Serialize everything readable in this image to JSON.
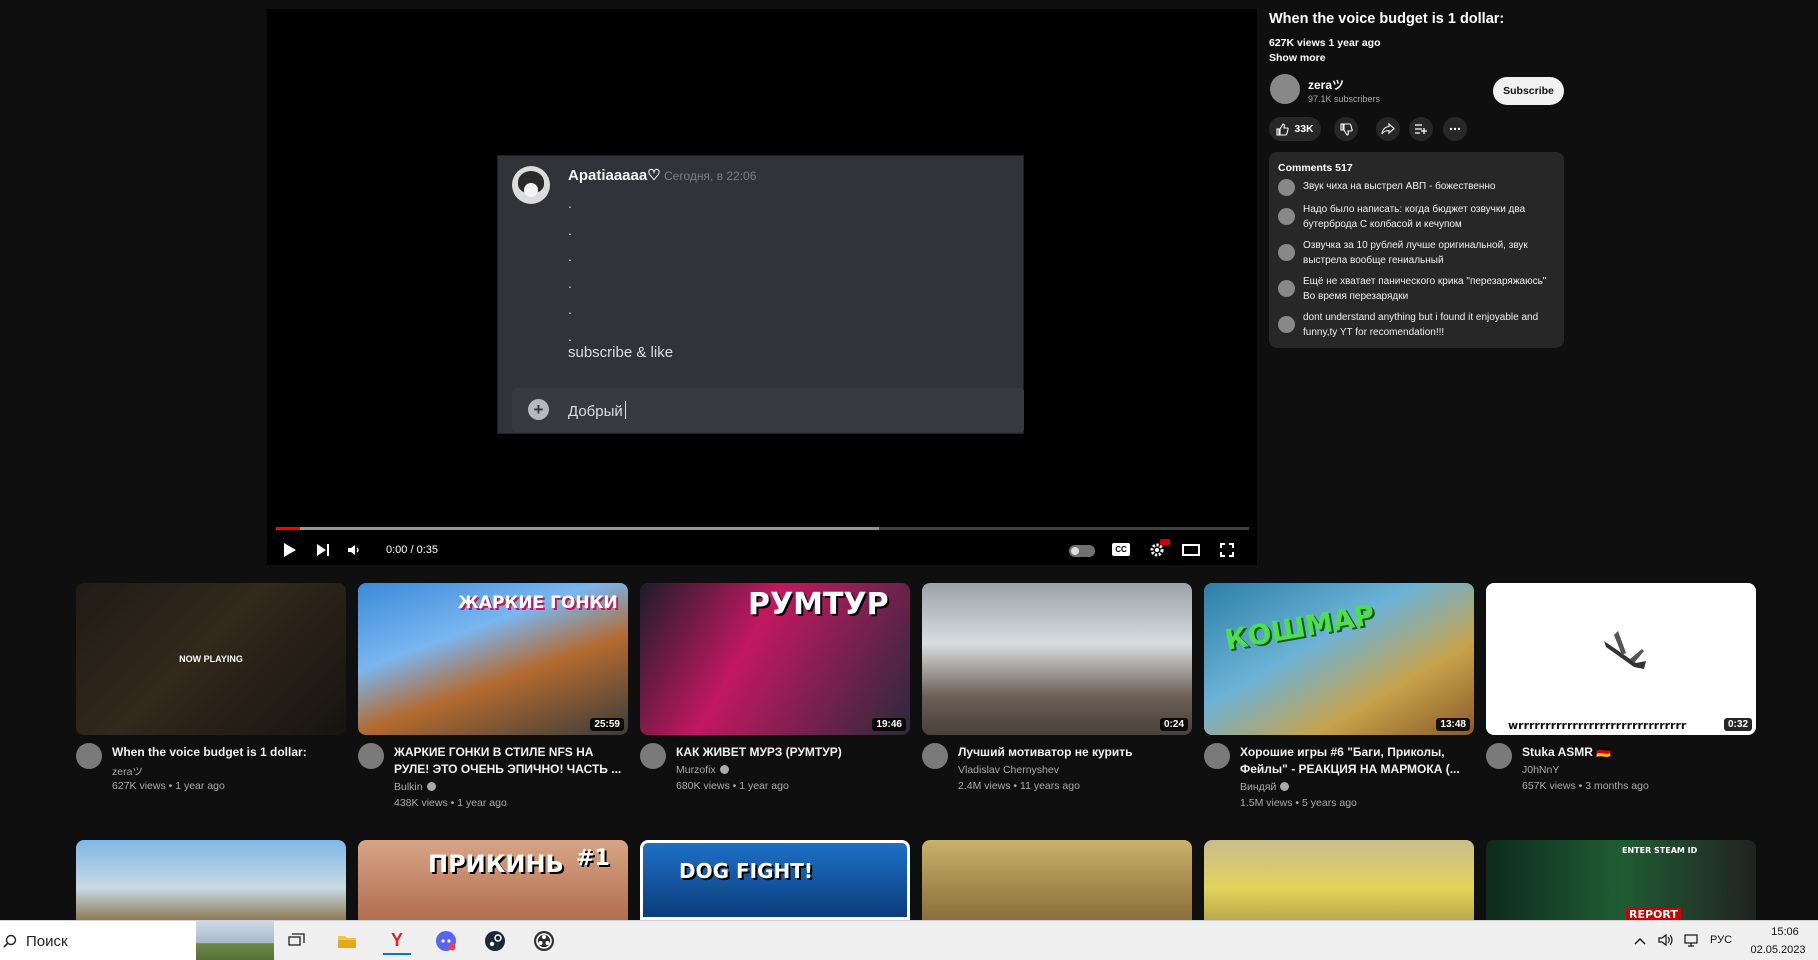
{
  "video": {
    "title": "When the voice budget is 1 dollar:",
    "meta": "627K views  1 year ago",
    "show_more": "Show more",
    "player": {
      "user": "Apatiaaaaa♡",
      "timestamp": "Сегодня, в 22:06",
      "dots": [
        ".",
        ".",
        ".",
        ".",
        ".",
        "."
      ],
      "message": "subscribe & like",
      "draft": "Добрый",
      "time": "0:00 / 0:35",
      "progress_fraction": 0.025,
      "buffer_fraction": 0.62
    }
  },
  "channel": {
    "name": "zeraツ",
    "subscribers": "97.1K subscribers",
    "subscribe_label": "Subscribe"
  },
  "actions": {
    "likes": "33K"
  },
  "comments": {
    "header": "Comments 517",
    "items": [
      "Звук чиха на выстрел АВП - божественно",
      "Надо было написать: когда бюджет озвучки два бутерброда С колбасой и кечупом",
      "Озвучка за 10 рублей лучше оригинальной, звук выстрела вообще гениальный",
      "Ещё не хватает панического крика \"перезаряжаюсь\" Во время перезарядки",
      "dont understand anything but i found it enjoyable and funny,ty YT for recomendation!!!"
    ]
  },
  "recommendations": [
    {
      "title": "When the voice budget is 1 dollar:",
      "channel": "zeraツ",
      "views": "627K views • 1 year ago",
      "duration": "",
      "overlay": "NOW PLAYING",
      "verified": false
    },
    {
      "title": "ЖАРКИЕ ГОНКИ В СТИЛЕ NFS НА РУЛЕ! ЭТО ОЧЕНЬ ЭПИЧНО! ЧАСТЬ ...",
      "channel": "Bulkin",
      "views": "438K views • 1 year ago",
      "duration": "25:59",
      "overlay": "ЖАРКИЕ ГОНКИ",
      "verified": true
    },
    {
      "title": "КАК ЖИВЕТ МУРЗ (РУМТУР)",
      "channel": "Murzofix",
      "views": "680K views • 1 year ago",
      "duration": "19:46",
      "overlay": "РУМТУР",
      "verified": true
    },
    {
      "title": "Лучший мотиватор не курить",
      "channel": "Vladislav Chernyshev",
      "views": "2.4M views • 11 years ago",
      "duration": "0:24",
      "overlay": "",
      "verified": false
    },
    {
      "title": "Хорошие игры #6 \"Баги, Приколы, Фейлы\" - РЕАКЦИЯ НА МАРМОКА (...",
      "channel": "Виндяй",
      "views": "1.5M views • 5 years ago",
      "duration": "13:48",
      "overlay": "КОШМАР",
      "verified": true
    },
    {
      "title": "Stuka ASMR 🇩🇪",
      "channel": "J0hNnY",
      "views": "657K views • 3 months ago",
      "duration": "0:32",
      "overlay": "wrrrrrrrrrrrrrrrrrrrrrrrrrrrrrrr",
      "verified": false
    }
  ],
  "row2_overlays": [
    "ПРИКИНЬ",
    "#1",
    "DOG FIGHT!",
    "ENTER STEAM ID",
    "REPORT"
  ],
  "taskbar": {
    "search": "Поиск",
    "language": "РУС",
    "time": "15:06",
    "date": "02.05.2023"
  },
  "colors": {
    "background": "#0f0f0f",
    "accent": "#ff0000",
    "discord_bg": "#313338"
  }
}
